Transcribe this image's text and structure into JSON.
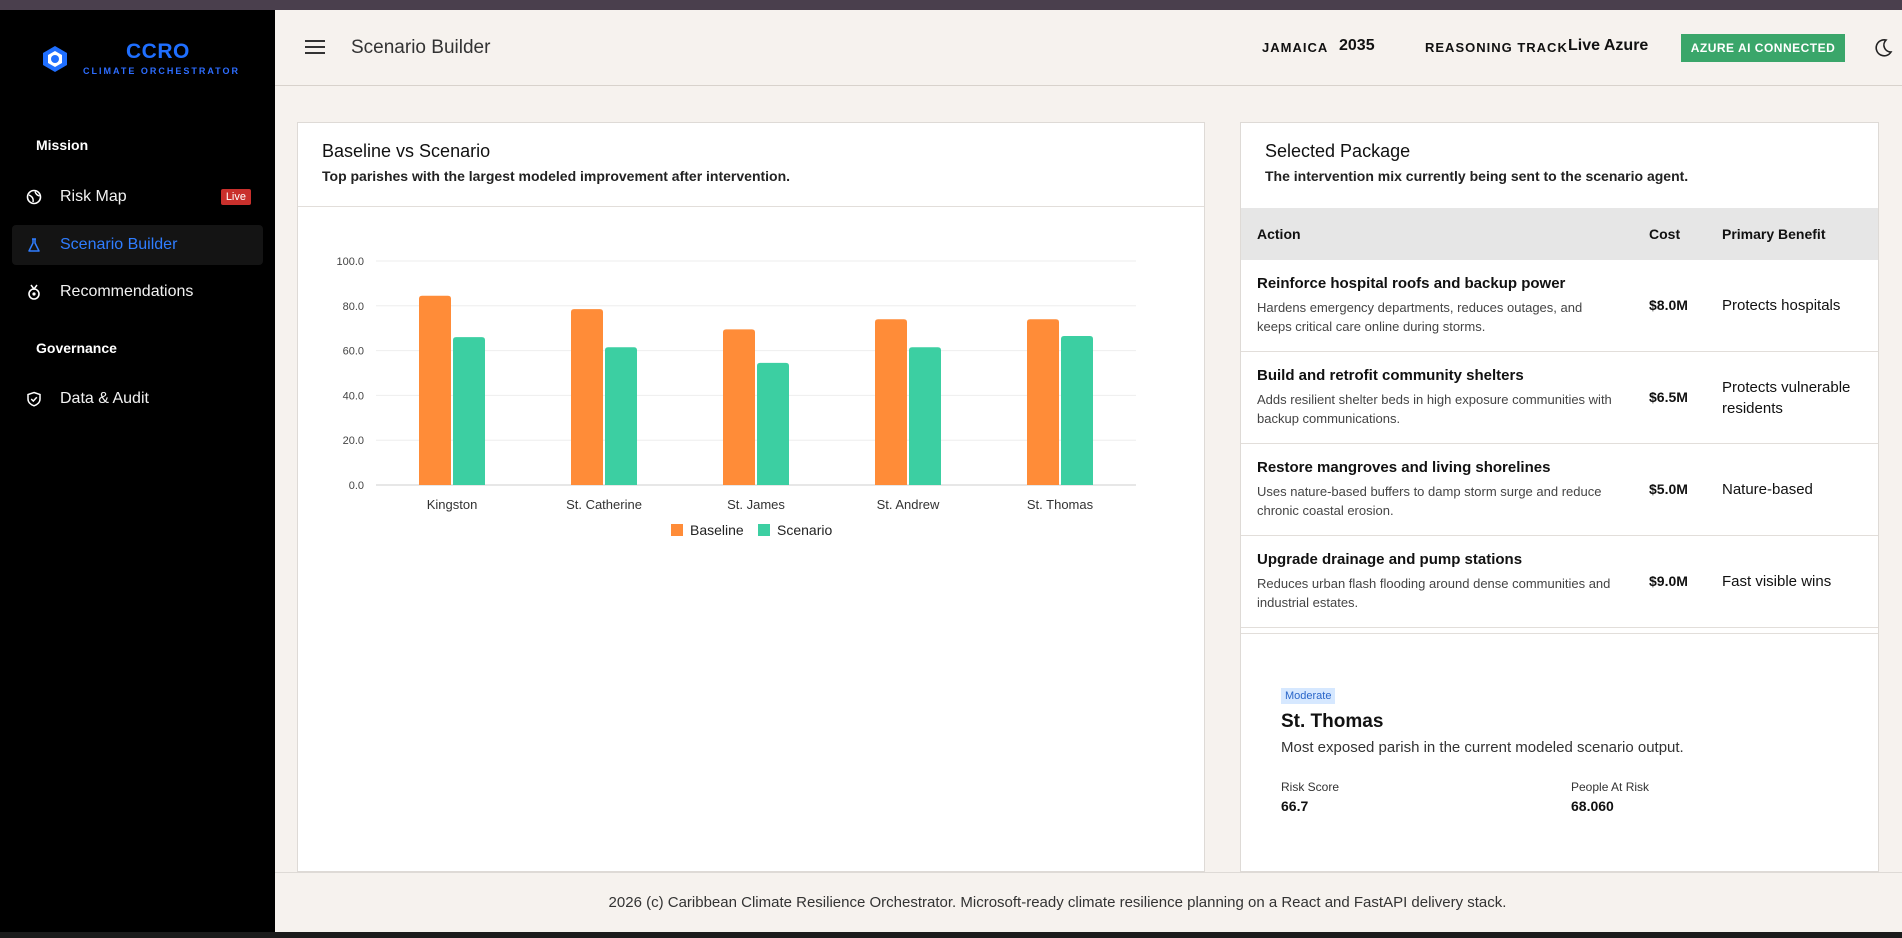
{
  "brand": {
    "name": "CCRO",
    "subtitle": "CLIMATE ORCHESTRATOR",
    "accent_color": "#1f6fff"
  },
  "sidebar": {
    "sections": [
      {
        "label": "Mission"
      },
      {
        "label": "Governance"
      }
    ],
    "items": [
      {
        "label": "Risk Map",
        "icon": "globe-icon",
        "badge": "Live"
      },
      {
        "label": "Scenario Builder",
        "icon": "flask-icon",
        "active": true
      },
      {
        "label": "Recommendations",
        "icon": "medal-icon"
      },
      {
        "label": "Data & Audit",
        "icon": "shield-check-icon"
      }
    ]
  },
  "header": {
    "title": "Scenario Builder",
    "country_label": "JAMAICA",
    "year": "2035",
    "track_label": "REASONING TRACK",
    "track_value": "Live Azure",
    "status_button": "AZURE AI CONNECTED",
    "status_color": "#3aa66a",
    "theme_icon": "moon-icon"
  },
  "chart_card": {
    "title": "Baseline vs Scenario",
    "subtitle": "Top parishes with the largest modeled improvement after intervention."
  },
  "chart_data": {
    "type": "bar",
    "categories": [
      "Kingston",
      "St. Catherine",
      "St. James",
      "St. Andrew",
      "St. Thomas"
    ],
    "series": [
      {
        "name": "Baseline",
        "values": [
          84.5,
          78.5,
          69.5,
          74.0,
          74.0
        ],
        "color": "#ff8c38"
      },
      {
        "name": "Scenario",
        "values": [
          66.0,
          61.5,
          54.5,
          61.5,
          66.5
        ],
        "color": "#3ccfa2"
      }
    ],
    "ylim": [
      0,
      100
    ],
    "yticks": [
      "0.0",
      "20.0",
      "40.0",
      "60.0",
      "80.0",
      "100.0"
    ],
    "grid": true,
    "legend": "bottom"
  },
  "package_card": {
    "title": "Selected Package",
    "subtitle": "The intervention mix currently being sent to the scenario agent.",
    "columns": [
      "Action",
      "Cost",
      "Primary Benefit"
    ],
    "rows": [
      {
        "title": "Reinforce hospital roofs and backup power",
        "desc": "Hardens emergency departments, reduces outages, and keeps critical care online during storms.",
        "cost": "$8.0M",
        "benefit": "Protects hospitals"
      },
      {
        "title": "Build and retrofit community shelters",
        "desc": "Adds resilient shelter beds in high exposure communities with backup communications.",
        "cost": "$6.5M",
        "benefit": "Protects vulnerable residents"
      },
      {
        "title": "Restore mangroves and living shorelines",
        "desc": "Uses nature-based buffers to damp storm surge and reduce chronic coastal erosion.",
        "cost": "$5.0M",
        "benefit": "Nature-based"
      },
      {
        "title": "Upgrade drainage and pump stations",
        "desc": "Reduces urban flash flooding around dense communities and industrial estates.",
        "cost": "$9.0M",
        "benefit": "Fast visible wins"
      }
    ],
    "parish": {
      "badge": "Moderate",
      "name": "St. Thomas",
      "desc": "Most exposed parish in the current modeled scenario output.",
      "risk_label": "Risk Score",
      "risk_value": "66.7",
      "people_label": "People At Risk",
      "people_value": "68.060"
    }
  },
  "footer": {
    "text": "2026 (c) Caribbean Climate Resilience Orchestrator. Microsoft-ready climate resilience planning on a React and FastAPI delivery stack."
  }
}
